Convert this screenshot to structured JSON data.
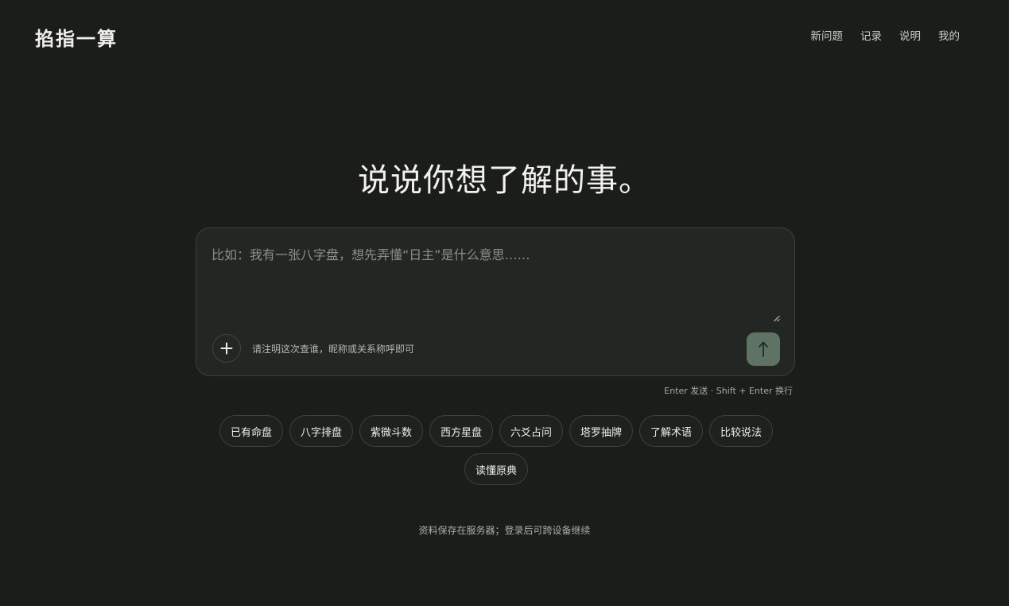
{
  "brand": {
    "name": "掐指一算"
  },
  "nav": {
    "items": [
      {
        "label": "新问题"
      },
      {
        "label": "记录"
      },
      {
        "label": "说明"
      },
      {
        "label": "我的"
      }
    ]
  },
  "hero": {
    "title": "说说你想了解的事。"
  },
  "composer": {
    "question_value": "",
    "question_placeholder": "比如：我有一张八字盘，想先弄懂“日主”是什么意思……",
    "note_value": "",
    "note_placeholder": "请注明这次查谁，昵称或关系称呼即可",
    "attach_icon": "plus-icon",
    "send_icon": "arrow-up-icon",
    "send_color": "#5e7363"
  },
  "hint": "Enter 发送 · Shift + Enter 换行",
  "chips": [
    {
      "label": "已有命盘"
    },
    {
      "label": "八字排盘"
    },
    {
      "label": "紫微斗数"
    },
    {
      "label": "西方星盘"
    },
    {
      "label": "六爻占问"
    },
    {
      "label": "塔罗抽牌"
    },
    {
      "label": "了解术语"
    },
    {
      "label": "比较说法"
    },
    {
      "label": "读懂原典"
    }
  ],
  "footer": {
    "note": "资料保存在服务器；登录后可跨设备继续"
  }
}
